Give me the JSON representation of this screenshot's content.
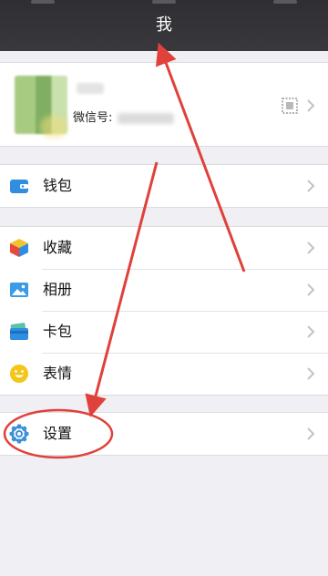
{
  "navbar": {
    "title": "我"
  },
  "profile": {
    "wechat_id_label": "微信号:"
  },
  "menu": {
    "wallet": {
      "label": "钱包"
    },
    "favorites": {
      "label": "收藏"
    },
    "album": {
      "label": "相册"
    },
    "cards": {
      "label": "卡包"
    },
    "stickers": {
      "label": "表情"
    },
    "settings": {
      "label": "设置"
    }
  },
  "colors": {
    "navbar_bg": "#2f2f33",
    "page_bg": "#efeff4",
    "annotation_red": "#e0413a",
    "settings_icon": "#3c8fd8"
  }
}
